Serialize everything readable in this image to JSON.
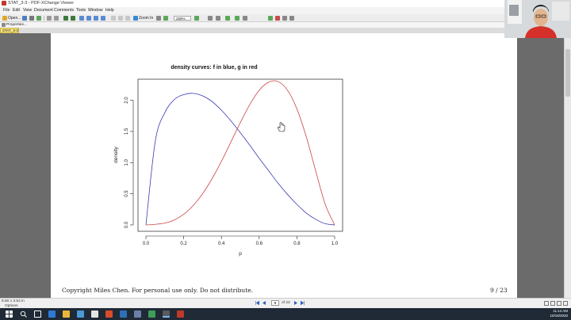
{
  "window": {
    "title": "STAT_3-3 - PDF-XChange Viewer"
  },
  "menu": [
    "File",
    "Edit",
    "View",
    "Document",
    "Comments",
    "Tools",
    "Window",
    "Help"
  ],
  "toolbar": {
    "open_label": "Open...",
    "zoom_in_label": "Zoom In",
    "zoom_value": "259%"
  },
  "properties": {
    "label": "Properties..."
  },
  "doc_tab": {
    "label": "STAT_3-3"
  },
  "page": {
    "copyright": "Copyright Miles Chen. For personal use only. Do not distribute.",
    "page_indicator": "9 / 23"
  },
  "statusbar": {
    "dimensions": "8.50 x 3.54 in",
    "options_label": "Options",
    "current_page": "9",
    "of_pages": "of 23"
  },
  "clock": {
    "time": "11:14 AM",
    "date": "10/18/2020"
  },
  "chart_data": {
    "type": "line",
    "title": "density curves: f in blue, g in red",
    "xlabel": "p",
    "ylabel": "density",
    "xlim": [
      0,
      1
    ],
    "ylim": [
      0,
      2.35
    ],
    "x_ticks": [
      "0.0",
      "0.2",
      "0.4",
      "0.6",
      "0.8",
      "1.0"
    ],
    "y_ticks": [
      "0.0",
      "0.5",
      "1.0",
      "1.5",
      "2.0"
    ],
    "grid": false,
    "x": [
      0,
      0.05,
      0.1,
      0.15,
      0.2,
      0.25,
      0.3,
      0.35,
      0.4,
      0.45,
      0.5,
      0.55,
      0.6,
      0.65,
      0.7,
      0.75,
      0.8,
      0.85,
      0.9,
      0.95,
      1
    ],
    "series": [
      {
        "name": "f",
        "color": "#3b3bb3",
        "values": [
          0,
          1.35,
          1.8,
          2.01,
          2.09,
          2.11,
          2.07,
          1.98,
          1.84,
          1.67,
          1.48,
          1.28,
          1.07,
          0.87,
          0.67,
          0.49,
          0.33,
          0.19,
          0.09,
          0.02,
          0
        ]
      },
      {
        "name": "g",
        "color": "#cc4444",
        "values": [
          0,
          0.01,
          0.03,
          0.08,
          0.17,
          0.31,
          0.5,
          0.74,
          1.02,
          1.33,
          1.64,
          1.93,
          2.16,
          2.29,
          2.3,
          2.16,
          1.86,
          1.41,
          0.86,
          0.33,
          0
        ]
      }
    ]
  },
  "colors": {
    "accent": "#f7e27a",
    "taskbar": "#1f2a36",
    "f_curve": "#3b3bb3",
    "g_curve": "#cc4444"
  },
  "icons": [
    "app-icon",
    "open-folder-icon",
    "save-icon",
    "print-icon",
    "zoom-in-icon",
    "hand-cursor-icon",
    "first-page-icon",
    "prev-page-icon",
    "next-page-icon",
    "last-page-icon",
    "windows-start-icon"
  ]
}
